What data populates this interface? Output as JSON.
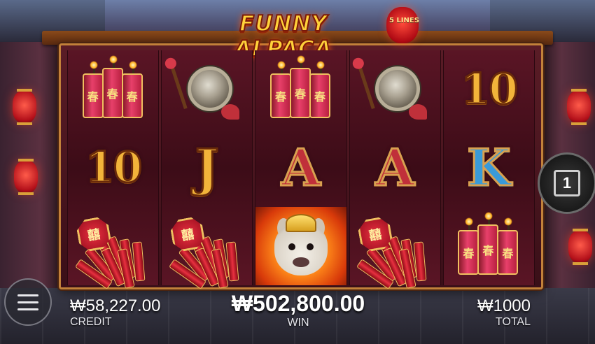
{
  "game": {
    "title": "FUNNY ALPACA",
    "lines_label": "5 LINES"
  },
  "reels": [
    [
      "firecrackers",
      "10",
      "firecracker-bundle"
    ],
    [
      "gong",
      "J",
      "firecracker-bundle"
    ],
    [
      "firecrackers",
      "A",
      "alpaca"
    ],
    [
      "gong",
      "A",
      "firecracker-bundle"
    ],
    [
      "10",
      "K",
      "firecrackers"
    ]
  ],
  "symbols": {
    "firecracker_char": "春",
    "bundle_char": "囍"
  },
  "line_button": {
    "value": "1"
  },
  "stats": {
    "credit_value": "₩58,227.00",
    "credit_label": "CREDIT",
    "win_value": "₩502,800.00",
    "win_label": "WIN",
    "total_value": "₩1000",
    "total_label": "TOTAL"
  },
  "colors": {
    "letter_gold": "#f2b43a",
    "letter_red": "#c0303a",
    "letter_blue": "#3a9ad8",
    "frame_gold": "#c2813a"
  }
}
